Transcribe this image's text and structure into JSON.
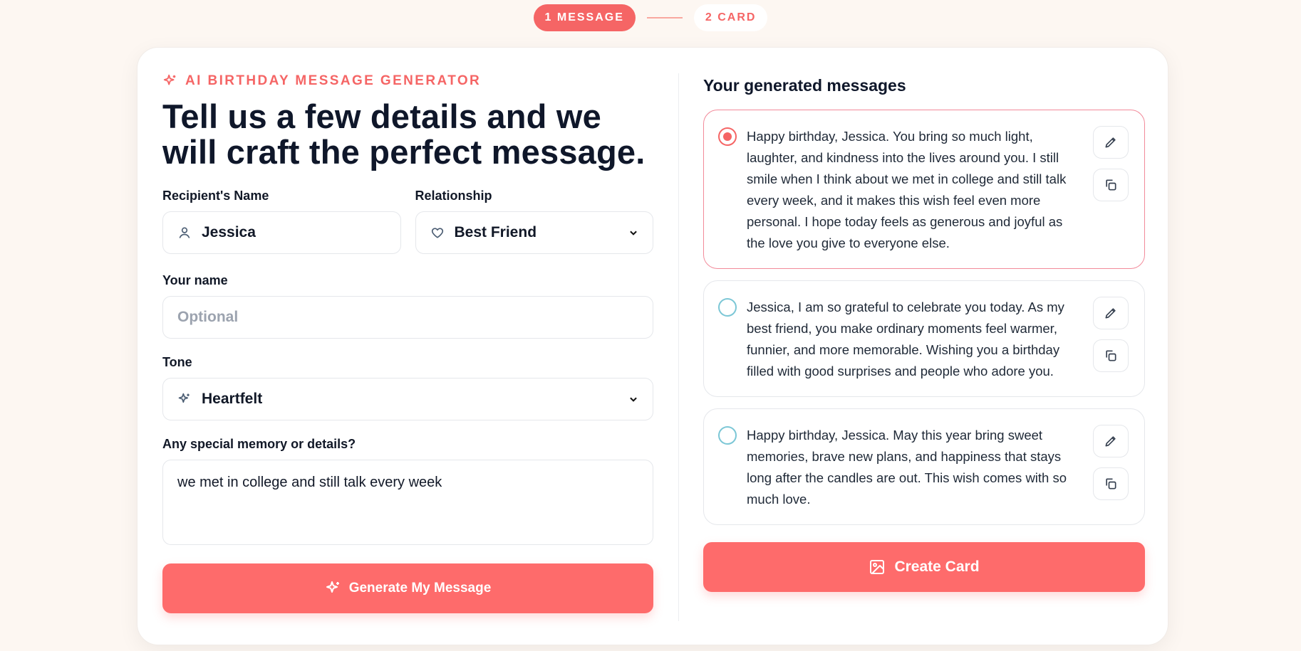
{
  "stepper": {
    "steps": [
      {
        "label": "1 MESSAGE",
        "active": true
      },
      {
        "label": "2 CARD",
        "active": false
      }
    ]
  },
  "form": {
    "eyebrow": "AI BIRTHDAY MESSAGE GENERATOR",
    "headline": "Tell us a few details and we will craft the perfect message.",
    "recipient_label": "Recipient's Name",
    "recipient_value": "Jessica",
    "relationship_label": "Relationship",
    "relationship_value": "Best Friend",
    "your_name_label": "Your name",
    "your_name_placeholder": "Optional",
    "tone_label": "Tone",
    "tone_value": "Heartfelt",
    "memory_label": "Any special memory or details?",
    "memory_value": "we met in college and still talk every week",
    "generate_label": "Generate My Message"
  },
  "results": {
    "title": "Your generated messages",
    "messages": [
      {
        "text": "Happy birthday, Jessica. You bring so much light, laughter, and kindness into the lives around you. I still smile when I think about we met in college and still talk every week, and it makes this wish feel even more personal. I hope today feels as generous and joyful as the love you give to everyone else.",
        "selected": true
      },
      {
        "text": "Jessica, I am so grateful to celebrate you today. As my best friend, you make ordinary moments feel warmer, funnier, and more memorable. Wishing you a birthday filled with good surprises and people who adore you.",
        "selected": false
      },
      {
        "text": "Happy birthday, Jessica. May this year bring sweet memories, brave new plans, and happiness that stays long after the candles are out. This wish comes with so much love.",
        "selected": false
      }
    ],
    "create_label": "Create Card"
  },
  "colors": {
    "accent": "#fe6b6b",
    "background": "#fdf7f2",
    "radio_unselected": "#7cc7d6"
  },
  "icons": [
    "sparkle-icon",
    "user-icon",
    "heart-icon",
    "chevron-down-icon",
    "pencil-icon",
    "copy-icon",
    "image-icon"
  ]
}
